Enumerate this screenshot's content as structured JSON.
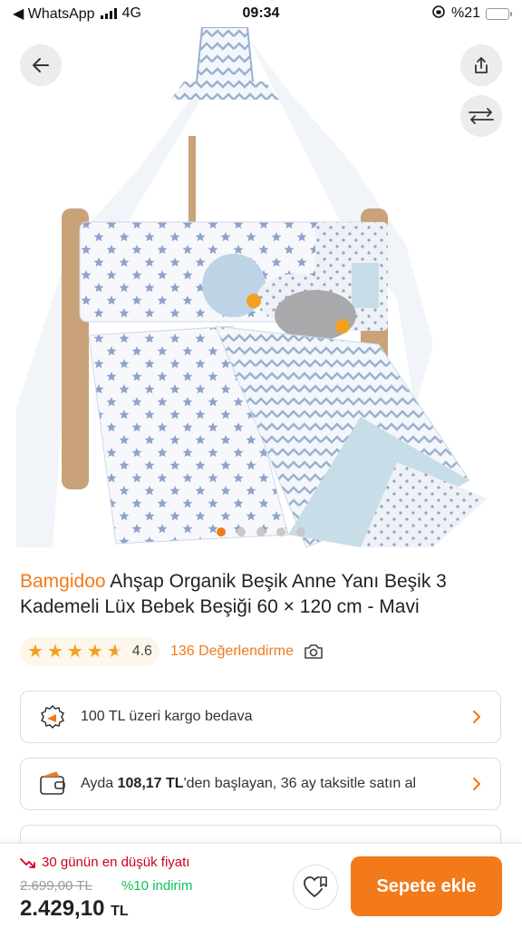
{
  "status_bar": {
    "back_app": "◀ WhatsApp",
    "network": "4G",
    "time": "09:34",
    "battery": "%21",
    "battery_level": 0.21
  },
  "gallery": {
    "image_count": 5,
    "active_index": 0,
    "icons": [
      "back-arrow-icon",
      "share-icon",
      "compare-icon"
    ]
  },
  "product": {
    "brand": "Bamgidoo",
    "name": " Ahşap Organik Beşik Anne Yanı Beşik 3 Kademeli Lüx Bebek Beşiği 60 × 120 cm - Mavi"
  },
  "rating": {
    "stars": 4.6,
    "score": "4.6",
    "reviews": "136 Değerlendirme"
  },
  "cards": {
    "shipping": "100 TL üzeri kargo bedava",
    "installment_prefix": "Ayda ",
    "installment_amount": "108,17 TL",
    "installment_suffix": "'den başlayan, 36 ay taksitle satın al"
  },
  "bottom": {
    "lowest_price_label": "30 günün en düşük fiyatı",
    "old_price": "2.699,00 TL",
    "discount": "%10 indirim",
    "price": "2.429,10",
    "currency": "TL",
    "cart_button": "Sepete ekle"
  },
  "colors": {
    "accent": "#f27a1a",
    "star": "#f2a01f",
    "discount_green": "#0bc15c",
    "alert_red": "#d0021b"
  }
}
